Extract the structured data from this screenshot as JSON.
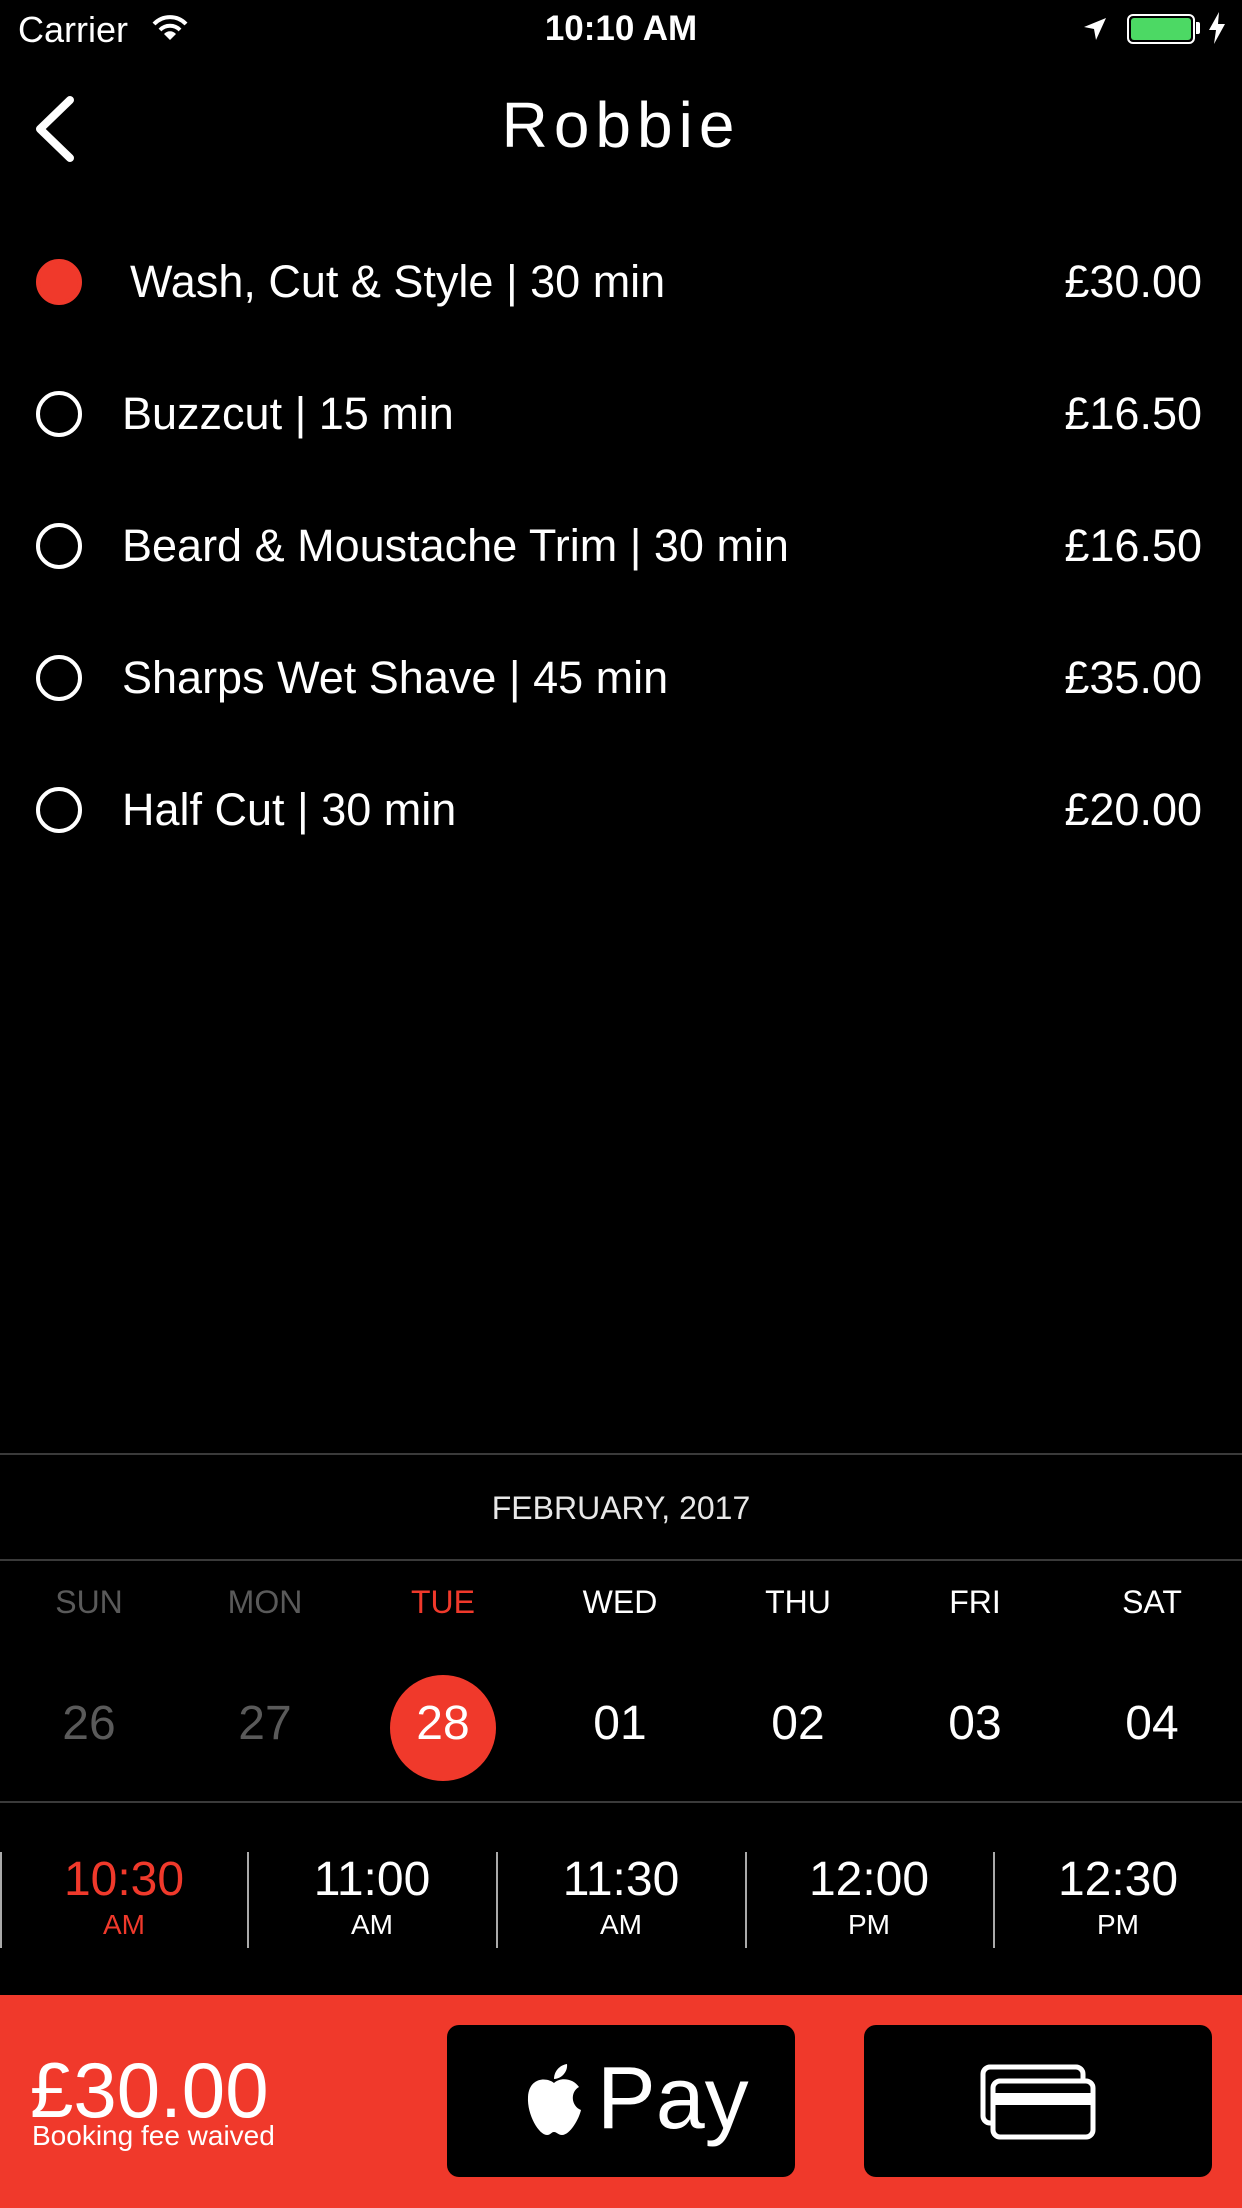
{
  "status_bar": {
    "carrier": "Carrier",
    "time": "10:10 AM"
  },
  "header": {
    "title": "Robbie"
  },
  "services": [
    {
      "name": "Wash, Cut & Style | 30 min",
      "price": "£30.00",
      "selected": true
    },
    {
      "name": "Buzzcut | 15 min",
      "price": "£16.50",
      "selected": false
    },
    {
      "name": "Beard & Moustache Trim | 30 min",
      "price": "£16.50",
      "selected": false
    },
    {
      "name": "Sharps Wet Shave | 45 min",
      "price": "£35.00",
      "selected": false
    },
    {
      "name": "Half Cut | 30 min",
      "price": "£20.00",
      "selected": false
    }
  ],
  "calendar": {
    "month": "FEBRUARY, 2017",
    "days": [
      {
        "name": "SUN",
        "num": "26",
        "state": "past"
      },
      {
        "name": "MON",
        "num": "27",
        "state": "past"
      },
      {
        "name": "TUE",
        "num": "28",
        "state": "selected"
      },
      {
        "name": "WED",
        "num": "01",
        "state": "normal"
      },
      {
        "name": "THU",
        "num": "02",
        "state": "normal"
      },
      {
        "name": "FRI",
        "num": "03",
        "state": "normal"
      },
      {
        "name": "SAT",
        "num": "04",
        "state": "normal"
      }
    ]
  },
  "time_slots": [
    {
      "time": "10:30",
      "period": "AM",
      "selected": true
    },
    {
      "time": "11:00",
      "period": "AM",
      "selected": false
    },
    {
      "time": "11:30",
      "period": "AM",
      "selected": false
    },
    {
      "time": "12:00",
      "period": "PM",
      "selected": false
    },
    {
      "time": "12:30",
      "period": "PM",
      "selected": false
    }
  ],
  "footer": {
    "total": "£30.00",
    "fee_note": "Booking fee waived",
    "apple_pay_label": "Pay",
    "card_icon": "credit-card-icon"
  },
  "colors": {
    "accent": "#f0392b",
    "background": "#000000",
    "battery": "#4cd964"
  }
}
